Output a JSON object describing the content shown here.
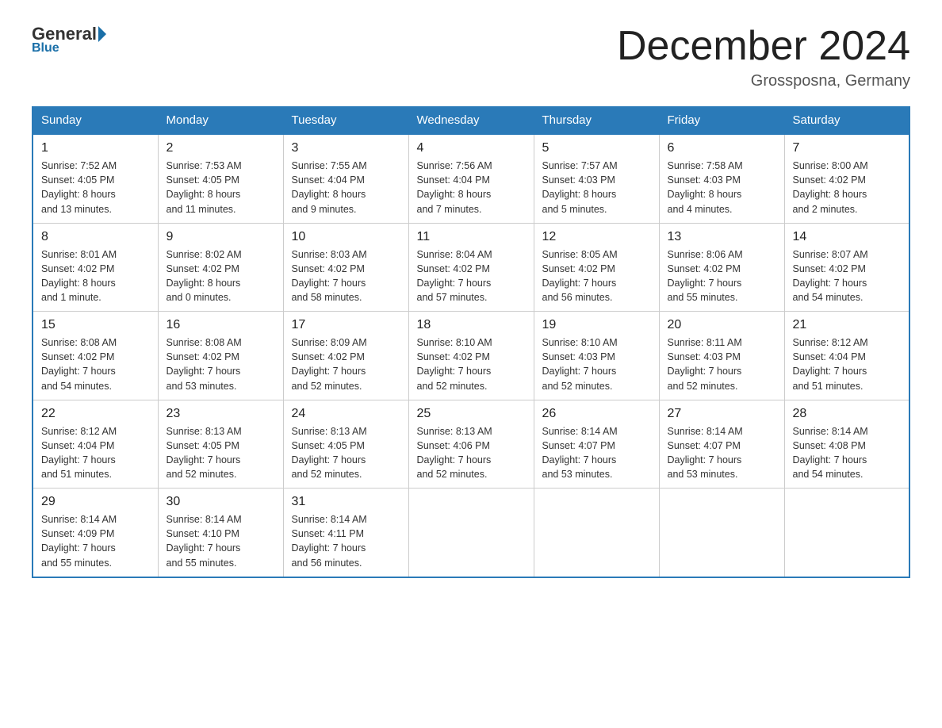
{
  "header": {
    "logo_general": "General",
    "logo_blue": "Blue",
    "month_title": "December 2024",
    "location": "Grossposna, Germany"
  },
  "weekdays": [
    "Sunday",
    "Monday",
    "Tuesday",
    "Wednesday",
    "Thursday",
    "Friday",
    "Saturday"
  ],
  "weeks": [
    [
      {
        "day": "1",
        "info": "Sunrise: 7:52 AM\nSunset: 4:05 PM\nDaylight: 8 hours\nand 13 minutes."
      },
      {
        "day": "2",
        "info": "Sunrise: 7:53 AM\nSunset: 4:05 PM\nDaylight: 8 hours\nand 11 minutes."
      },
      {
        "day": "3",
        "info": "Sunrise: 7:55 AM\nSunset: 4:04 PM\nDaylight: 8 hours\nand 9 minutes."
      },
      {
        "day": "4",
        "info": "Sunrise: 7:56 AM\nSunset: 4:04 PM\nDaylight: 8 hours\nand 7 minutes."
      },
      {
        "day": "5",
        "info": "Sunrise: 7:57 AM\nSunset: 4:03 PM\nDaylight: 8 hours\nand 5 minutes."
      },
      {
        "day": "6",
        "info": "Sunrise: 7:58 AM\nSunset: 4:03 PM\nDaylight: 8 hours\nand 4 minutes."
      },
      {
        "day": "7",
        "info": "Sunrise: 8:00 AM\nSunset: 4:02 PM\nDaylight: 8 hours\nand 2 minutes."
      }
    ],
    [
      {
        "day": "8",
        "info": "Sunrise: 8:01 AM\nSunset: 4:02 PM\nDaylight: 8 hours\nand 1 minute."
      },
      {
        "day": "9",
        "info": "Sunrise: 8:02 AM\nSunset: 4:02 PM\nDaylight: 8 hours\nand 0 minutes."
      },
      {
        "day": "10",
        "info": "Sunrise: 8:03 AM\nSunset: 4:02 PM\nDaylight: 7 hours\nand 58 minutes."
      },
      {
        "day": "11",
        "info": "Sunrise: 8:04 AM\nSunset: 4:02 PM\nDaylight: 7 hours\nand 57 minutes."
      },
      {
        "day": "12",
        "info": "Sunrise: 8:05 AM\nSunset: 4:02 PM\nDaylight: 7 hours\nand 56 minutes."
      },
      {
        "day": "13",
        "info": "Sunrise: 8:06 AM\nSunset: 4:02 PM\nDaylight: 7 hours\nand 55 minutes."
      },
      {
        "day": "14",
        "info": "Sunrise: 8:07 AM\nSunset: 4:02 PM\nDaylight: 7 hours\nand 54 minutes."
      }
    ],
    [
      {
        "day": "15",
        "info": "Sunrise: 8:08 AM\nSunset: 4:02 PM\nDaylight: 7 hours\nand 54 minutes."
      },
      {
        "day": "16",
        "info": "Sunrise: 8:08 AM\nSunset: 4:02 PM\nDaylight: 7 hours\nand 53 minutes."
      },
      {
        "day": "17",
        "info": "Sunrise: 8:09 AM\nSunset: 4:02 PM\nDaylight: 7 hours\nand 52 minutes."
      },
      {
        "day": "18",
        "info": "Sunrise: 8:10 AM\nSunset: 4:02 PM\nDaylight: 7 hours\nand 52 minutes."
      },
      {
        "day": "19",
        "info": "Sunrise: 8:10 AM\nSunset: 4:03 PM\nDaylight: 7 hours\nand 52 minutes."
      },
      {
        "day": "20",
        "info": "Sunrise: 8:11 AM\nSunset: 4:03 PM\nDaylight: 7 hours\nand 52 minutes."
      },
      {
        "day": "21",
        "info": "Sunrise: 8:12 AM\nSunset: 4:04 PM\nDaylight: 7 hours\nand 51 minutes."
      }
    ],
    [
      {
        "day": "22",
        "info": "Sunrise: 8:12 AM\nSunset: 4:04 PM\nDaylight: 7 hours\nand 51 minutes."
      },
      {
        "day": "23",
        "info": "Sunrise: 8:13 AM\nSunset: 4:05 PM\nDaylight: 7 hours\nand 52 minutes."
      },
      {
        "day": "24",
        "info": "Sunrise: 8:13 AM\nSunset: 4:05 PM\nDaylight: 7 hours\nand 52 minutes."
      },
      {
        "day": "25",
        "info": "Sunrise: 8:13 AM\nSunset: 4:06 PM\nDaylight: 7 hours\nand 52 minutes."
      },
      {
        "day": "26",
        "info": "Sunrise: 8:14 AM\nSunset: 4:07 PM\nDaylight: 7 hours\nand 53 minutes."
      },
      {
        "day": "27",
        "info": "Sunrise: 8:14 AM\nSunset: 4:07 PM\nDaylight: 7 hours\nand 53 minutes."
      },
      {
        "day": "28",
        "info": "Sunrise: 8:14 AM\nSunset: 4:08 PM\nDaylight: 7 hours\nand 54 minutes."
      }
    ],
    [
      {
        "day": "29",
        "info": "Sunrise: 8:14 AM\nSunset: 4:09 PM\nDaylight: 7 hours\nand 55 minutes."
      },
      {
        "day": "30",
        "info": "Sunrise: 8:14 AM\nSunset: 4:10 PM\nDaylight: 7 hours\nand 55 minutes."
      },
      {
        "day": "31",
        "info": "Sunrise: 8:14 AM\nSunset: 4:11 PM\nDaylight: 7 hours\nand 56 minutes."
      },
      {
        "day": "",
        "info": ""
      },
      {
        "day": "",
        "info": ""
      },
      {
        "day": "",
        "info": ""
      },
      {
        "day": "",
        "info": ""
      }
    ]
  ]
}
